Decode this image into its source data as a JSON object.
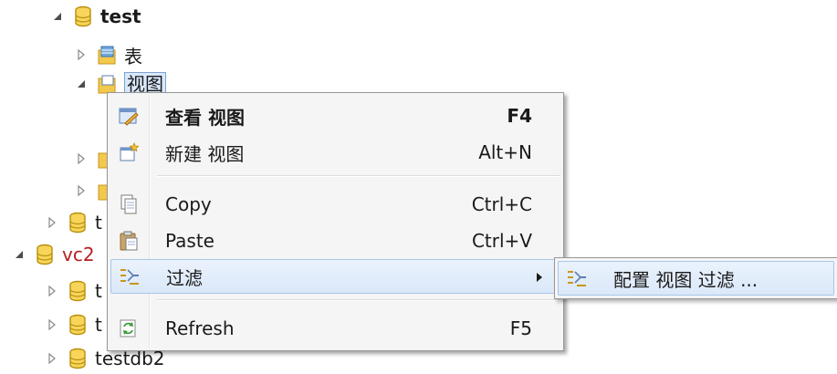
{
  "tree": {
    "rows": [
      {
        "label": "test"
      },
      {
        "label": "表"
      },
      {
        "label": "视图"
      },
      {
        "label": "t"
      },
      {
        "label": "vc2"
      },
      {
        "label": "t"
      },
      {
        "label": "t"
      },
      {
        "label": "testdb2"
      }
    ]
  },
  "context_menu": {
    "items": [
      {
        "label": "查看 视图",
        "shortcut": "F4",
        "icon": "view-icon"
      },
      {
        "label": "新建 视图",
        "shortcut": "Alt+N",
        "icon": "new-view-icon"
      },
      {
        "label": "Copy",
        "shortcut": "Ctrl+C",
        "icon": "copy-icon"
      },
      {
        "label": "Paste",
        "shortcut": "Ctrl+V",
        "icon": "paste-icon"
      },
      {
        "label": "过滤",
        "shortcut": "",
        "icon": "filter-icon"
      },
      {
        "label": "Refresh",
        "shortcut": "F5",
        "icon": "refresh-icon"
      }
    ]
  },
  "submenu": {
    "items": [
      {
        "label": "配置 视图 过滤 ...",
        "icon": "filter-icon"
      }
    ]
  },
  "colors": {
    "db_icon": "#f0c419",
    "highlight_border": "#a8c6ea",
    "highlight_bg": "#dbe8f9",
    "red_label": "#b52020"
  }
}
